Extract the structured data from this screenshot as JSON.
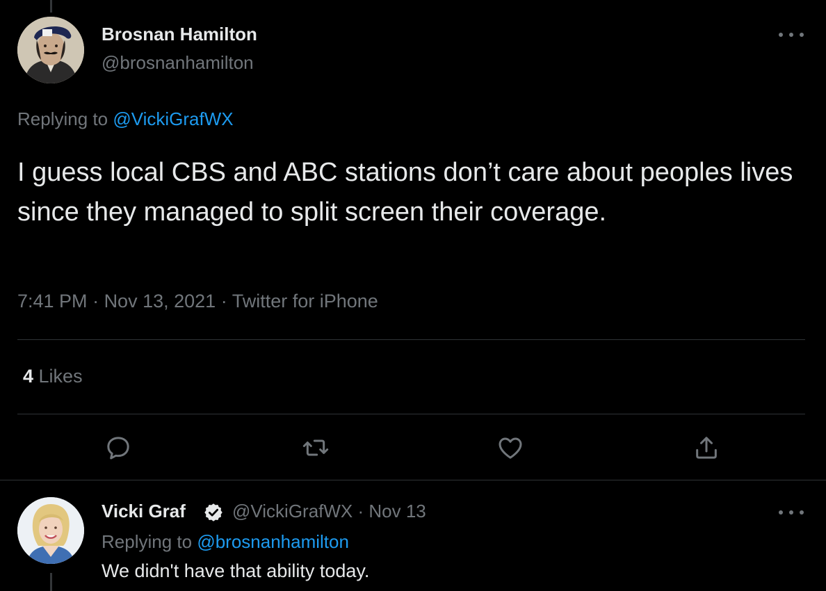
{
  "main_tweet": {
    "author_name": "Brosnan Hamilton",
    "author_handle": "@brosnanhamilton",
    "replying_prefix": "Replying to ",
    "replying_to": "@VickiGrafWX",
    "text": "I guess local CBS and ABC stations don’t care about peoples lives since they managed to split screen their coverage.",
    "time": "7:41 PM",
    "date": "Nov 13, 2021",
    "source": "Twitter for iPhone",
    "separator": " · ",
    "likes_count": "4",
    "likes_label": " Likes",
    "actions": [
      {
        "name": "reply",
        "icon": "reply-icon"
      },
      {
        "name": "retweet",
        "icon": "retweet-icon"
      },
      {
        "name": "like",
        "icon": "heart-icon"
      },
      {
        "name": "share",
        "icon": "share-icon"
      }
    ]
  },
  "reply_tweet": {
    "author_name": "Vicki Graf",
    "verified": true,
    "author_handle": "@VickiGrafWX",
    "separator": " · ",
    "date": "Nov 13",
    "replying_prefix": "Replying to ",
    "replying_to": "@brosnanhamilton",
    "text": "We didn't have that ability today."
  },
  "colors": {
    "background": "#000000",
    "text_primary": "#e7e9ea",
    "text_secondary": "#71767b",
    "link": "#1d9bf0",
    "divider": "#2f3336"
  }
}
